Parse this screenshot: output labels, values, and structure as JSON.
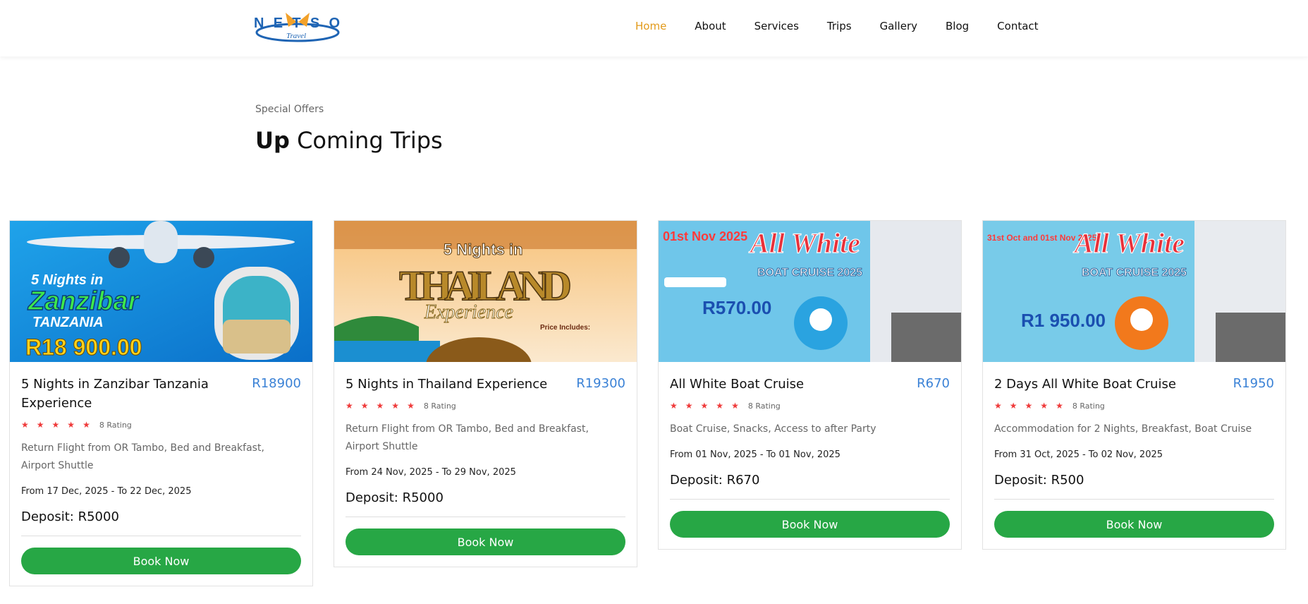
{
  "header": {
    "logo_text": "NETSO",
    "logo_subtext": "Travel",
    "nav": [
      {
        "label": "Home",
        "active": true
      },
      {
        "label": "About",
        "active": false
      },
      {
        "label": "Services",
        "active": false
      },
      {
        "label": "Trips",
        "active": false
      },
      {
        "label": "Gallery",
        "active": false
      },
      {
        "label": "Blog",
        "active": false
      },
      {
        "label": "Contact",
        "active": false
      }
    ]
  },
  "section": {
    "eyebrow": "Special Offers",
    "title_bold": "Up",
    "title_rest": " Coming Trips"
  },
  "colors": {
    "accent_orange": "#e29a1a",
    "price_blue": "#3b82d6",
    "button_green": "#27a745",
    "star_red": "#ef3a3a"
  },
  "trips": [
    {
      "title": "5 Nights in Zanzibar Tanzania Experience",
      "price": "R18900",
      "stars": 5,
      "rating_text": "8 Rating",
      "description": "Return Flight from OR Tambo, Bed and Breakfast, Airport Shuttle",
      "dates": "From 17 Dec, 2025 - To 22 Dec, 2025",
      "deposit": "Deposit: R5000",
      "button": "Book Now",
      "image": {
        "line1": "5 Nights in",
        "line2": "Zanzibar",
        "line3": "TANZANIA",
        "line4": "R18 900.00"
      }
    },
    {
      "title": "5 Nights in Thailand Experience",
      "price": "R19300",
      "stars": 5,
      "rating_text": "8 Rating",
      "description": "Return Flight from OR Tambo, Bed and Breakfast, Airport Shuttle",
      "dates": "From 24 Nov, 2025 - To 29 Nov, 2025",
      "deposit": "Deposit: R5000",
      "button": "Book Now",
      "image": {
        "line1": "5 Nights in",
        "line2": "THAILAND",
        "line3": "Experience",
        "line4": "Price Includes:"
      }
    },
    {
      "title": "All White Boat Cruise",
      "price": "R670",
      "stars": 5,
      "rating_text": "8 Rating",
      "description": "Boat Cruise, Snacks, Access to after Party",
      "dates": "From 01 Nov, 2025 - To 01 Nov, 2025",
      "deposit": "Deposit: R670",
      "button": "Book Now",
      "image": {
        "line1": "01st Nov 2025",
        "line2": "All White",
        "line3": "BOAT CRUISE 2025",
        "line4": "R570.00"
      }
    },
    {
      "title": "2 Days All White Boat Cruise",
      "price": "R1950",
      "stars": 5,
      "rating_text": "8 Rating",
      "description": "Accommodation for 2 Nights, Breakfast, Boat Cruise",
      "dates": "From 31 Oct, 2025 - To 02 Nov, 2025",
      "deposit": "Deposit: R500",
      "button": "Book Now",
      "image": {
        "line1": "31st Oct and 01st Nov 2025",
        "line2": "All White",
        "line3": "BOAT CRUISE 2025",
        "line4": "R1 950.00"
      }
    }
  ]
}
